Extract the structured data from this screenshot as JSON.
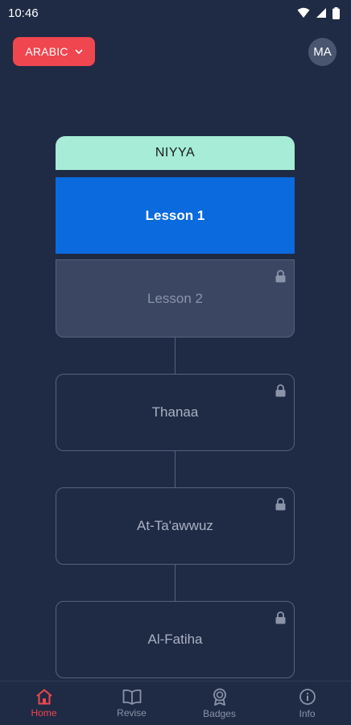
{
  "status_bar": {
    "time": "10:46"
  },
  "header": {
    "language_label": "ARABIC",
    "avatar_initials": "MA"
  },
  "unit": {
    "title": "NIYYA"
  },
  "lessons": [
    {
      "label": "Lesson 1",
      "state": "active",
      "locked": false
    },
    {
      "label": "Lesson 2",
      "state": "locked",
      "locked": true
    },
    {
      "label": "Thanaa",
      "state": "locked",
      "locked": true
    },
    {
      "label": "At-Ta'awwuz",
      "state": "locked",
      "locked": true
    },
    {
      "label": "Al-Fatiha",
      "state": "locked",
      "locked": true
    }
  ],
  "bottom_nav": [
    {
      "label": "Home",
      "icon": "home-icon",
      "active": true
    },
    {
      "label": "Revise",
      "icon": "book-icon",
      "active": false
    },
    {
      "label": "Badges",
      "icon": "badge-icon",
      "active": false
    },
    {
      "label": "Info",
      "icon": "info-icon",
      "active": false
    }
  ],
  "colors": {
    "background": "#1f2a44",
    "accent": "#f0464f",
    "active_lesson": "#0a6ade",
    "unit_header": "#a6ecd6"
  }
}
